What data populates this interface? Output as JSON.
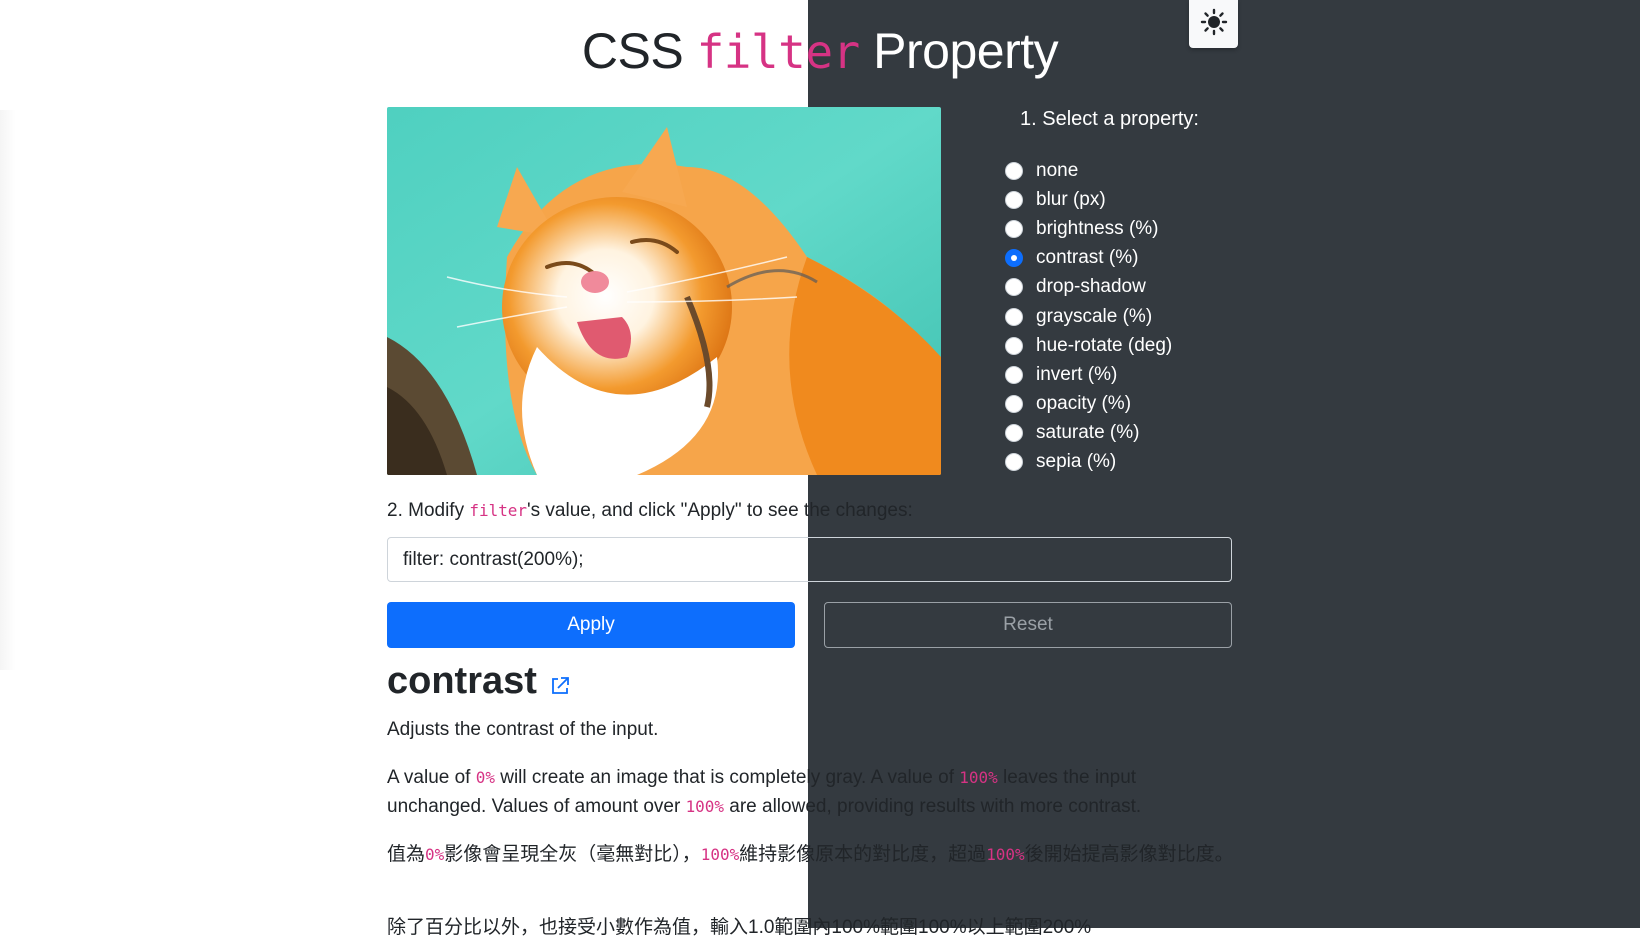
{
  "title": {
    "prefix": "CSS ",
    "code": "filter",
    "suffix": " Property"
  },
  "theme_toggle": {
    "icon": "sun-icon"
  },
  "image": {
    "alt": "cat"
  },
  "select": {
    "heading": "1. Select a property:",
    "options": [
      {
        "label": "none",
        "checked": false
      },
      {
        "label": "blur (px)",
        "checked": false
      },
      {
        "label": "brightness (%)",
        "checked": false
      },
      {
        "label": "contrast (%)",
        "checked": true
      },
      {
        "label": "drop-shadow",
        "checked": false
      },
      {
        "label": "grayscale (%)",
        "checked": false
      },
      {
        "label": "hue-rotate (deg)",
        "checked": false
      },
      {
        "label": "invert (%)",
        "checked": false
      },
      {
        "label": "opacity (%)",
        "checked": false
      },
      {
        "label": "saturate (%)",
        "checked": false
      },
      {
        "label": "sepia (%)",
        "checked": false
      }
    ]
  },
  "modify": {
    "prefix": "2. Modify ",
    "code": "filter",
    "suffix": "'s value, and click \"Apply\" to see the changes:",
    "input_value": "filter: contrast(200%);"
  },
  "buttons": {
    "apply": "Apply",
    "reset": "Reset"
  },
  "section": {
    "title": "contrast",
    "link_icon": "external-link-icon",
    "desc": "Adjusts the contrast of the input.",
    "p2_a": "A value of ",
    "p2_code1": "0%",
    "p2_b": " will create an image that is completely gray. A value of ",
    "p2_code2": "100%",
    "p2_c": " leaves the input unchanged. Values of amount over ",
    "p2_code3": "100%",
    "p2_d": " are allowed, providing results with more contrast.",
    "zh_a": "值為",
    "zh_code1": "0%",
    "zh_b": "影像會呈現全灰（毫無對比），",
    "zh_code2": "100%",
    "zh_c": "維持影像原本的對比度，超過",
    "zh_code3": "100%",
    "zh_d": "後開始提高影像對比度。",
    "zh_partial": "除了百分比以外，也接受小數作為值，輸入1.0範圍內100%範圍100%以上範圍200%"
  },
  "colors": {
    "accent": "#0d6efd",
    "code": "#d63384",
    "dark_bg": "#343a40"
  }
}
